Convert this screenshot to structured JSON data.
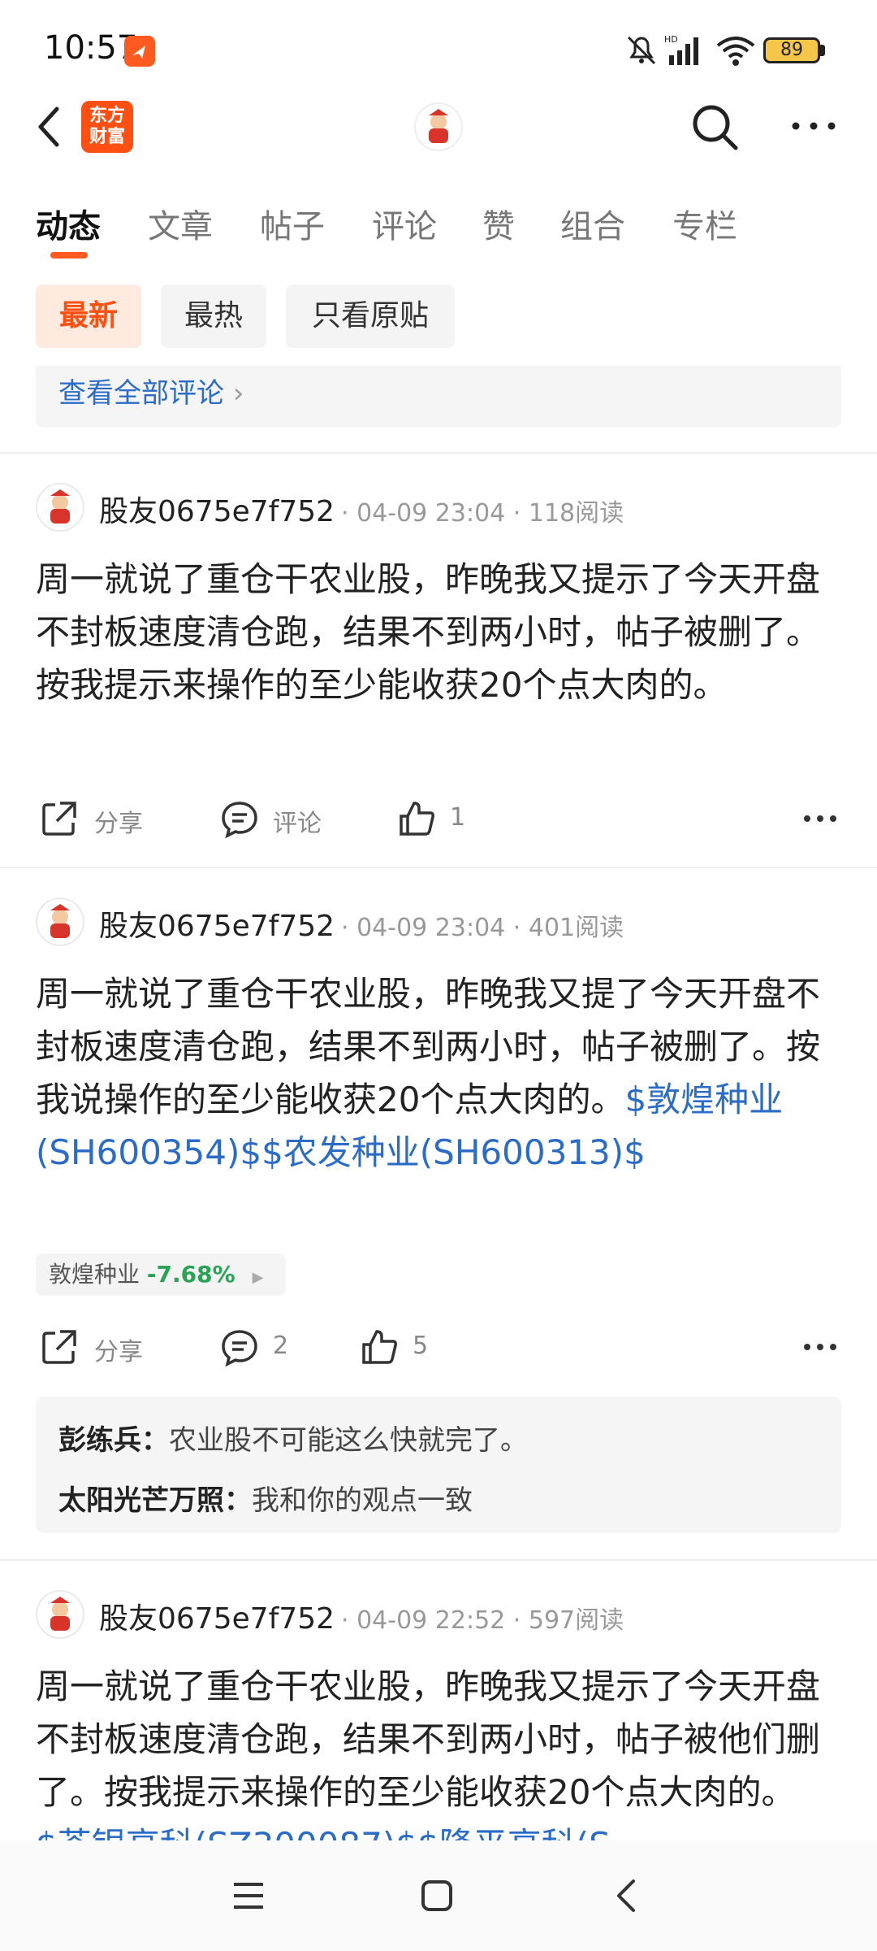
{
  "status_bar": {
    "time": "10:57",
    "battery": "89"
  },
  "header": {
    "brand_line1": "东方",
    "brand_line2": "财富"
  },
  "tabs": [
    "动态",
    "文章",
    "帖子",
    "评论",
    "赞",
    "组合",
    "专栏"
  ],
  "filters": [
    "最新",
    "最热",
    "只看原贴"
  ],
  "view_all_comments": "查看全部评论",
  "posts": [
    {
      "author": "股友0675e7f752",
      "time": "04-09 23:04",
      "reads": "118阅读",
      "content": "周一就说了重仓干农业股，昨晚我又提示了今天开盘不封板速度清仓跑，结果不到两小时，帖子被删了。按我提示来操作的至少能收获20个点大肉的。",
      "share": "分享",
      "comment": "评论",
      "likes": "1"
    },
    {
      "author": "股友0675e7f752",
      "time": "04-09 23:04",
      "reads": "401阅读",
      "content": "周一就说了重仓干农业股，昨晚我又提了今天开盘不封板速度清仓跑，结果不到两小时，帖子被删了。按我说操作的至少能收获20个点大肉的。",
      "links": "$敦煌种业(SH600354)$$农发种业(SH600313)$",
      "stock_name": "敦煌种业",
      "stock_change": "-7.68%",
      "share": "分享",
      "comment": "2",
      "likes": "5",
      "replies": [
        {
          "user": "彭练兵：",
          "text": "农业股不可能这么快就完了。"
        },
        {
          "user": "太阳光芒万照：",
          "text": "我和你的观点一致"
        }
      ]
    },
    {
      "author": "股友0675e7f752",
      "time": "04-09 22:52",
      "reads": "597阅读",
      "content": "周一就说了重仓干农业股，昨晚我又提示了今天开盘不封板速度清仓跑，结果不到两小时，帖子被他们删了。按我提示来操作的至少能收获20个点大肉的。",
      "links": "$荃银高科(SZ300087)$$隆平高科(S"
    }
  ],
  "colors": {
    "accent": "#ff4f12",
    "link": "#2a6cc7",
    "down": "#2aa454"
  }
}
